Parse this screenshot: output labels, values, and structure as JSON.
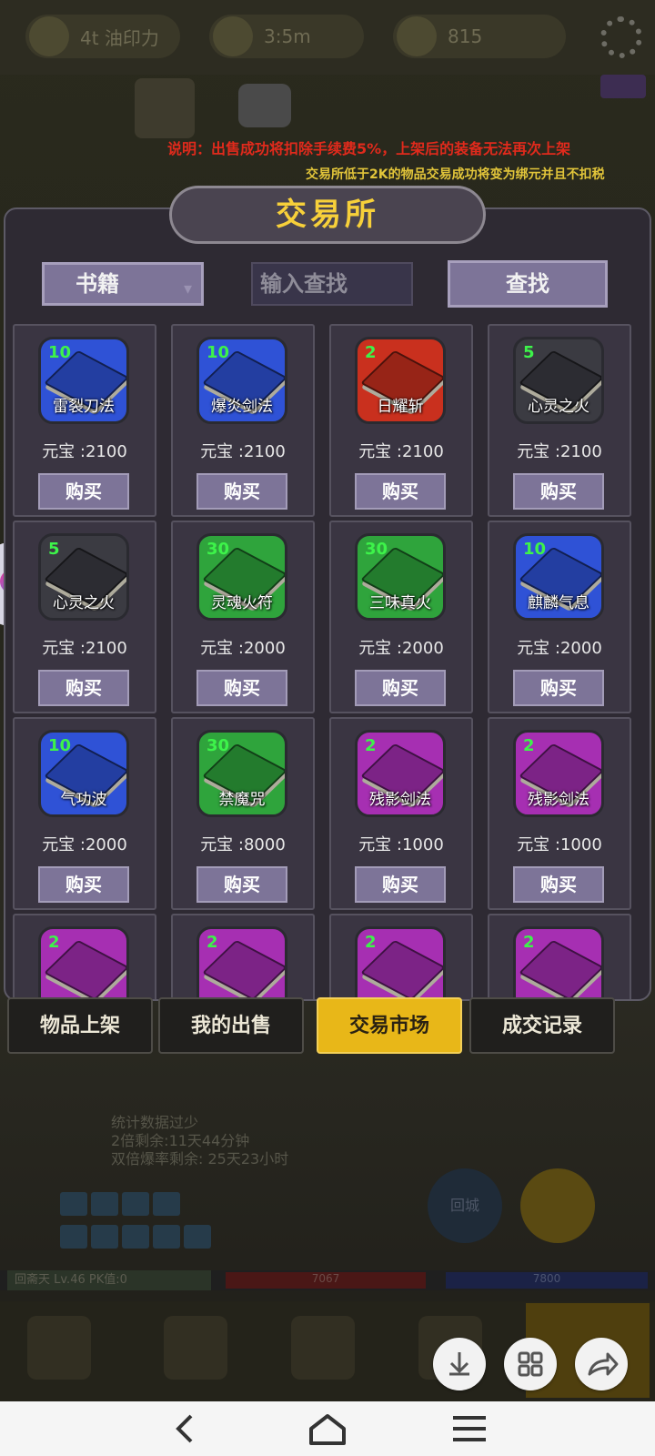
{
  "background": {
    "resources": [
      "4t 油印力",
      "3:5m",
      "815"
    ],
    "stats_lines": [
      "统计数据过少",
      "2倍剩余:11天44分钟",
      "双倍爆率剩余: 25天23小时"
    ],
    "player_bar": {
      "name": "回斋天  Lv.46 PK值:0",
      "hp": "7067",
      "mp": "7800"
    },
    "return_city": "回城"
  },
  "notices": {
    "line1": "说明：出售成功将扣除手续费5%，上架后的装备无法再次上架",
    "line2": "交易所低于2K的物品交易成功将变为绑元并且不扣税"
  },
  "dialog": {
    "title": "交易所",
    "category": "书籍",
    "search_placeholder": "输入查找",
    "search_button": "查找",
    "buy_label": "购买",
    "items": [
      {
        "name": "雷裂刀法",
        "qty": "10",
        "price": "元宝 :2100",
        "rarity": "blue"
      },
      {
        "name": "爆炎剑法",
        "qty": "10",
        "price": "元宝 :2100",
        "rarity": "blue"
      },
      {
        "name": "日耀斩",
        "qty": "2",
        "price": "元宝 :2100",
        "rarity": "red"
      },
      {
        "name": "心灵之火",
        "qty": "5",
        "price": "元宝 :2100",
        "rarity": "dark"
      },
      {
        "name": "心灵之火",
        "qty": "5",
        "price": "元宝 :2100",
        "rarity": "dark"
      },
      {
        "name": "灵魂火符",
        "qty": "30",
        "price": "元宝 :2000",
        "rarity": "green"
      },
      {
        "name": "三味真火",
        "qty": "30",
        "price": "元宝 :2000",
        "rarity": "green"
      },
      {
        "name": "麒麟气息",
        "qty": "10",
        "price": "元宝 :2000",
        "rarity": "blue"
      },
      {
        "name": "气功波",
        "qty": "10",
        "price": "元宝 :2000",
        "rarity": "blue"
      },
      {
        "name": "禁魔咒",
        "qty": "30",
        "price": "元宝 :8000",
        "rarity": "green"
      },
      {
        "name": "残影剑法",
        "qty": "2",
        "price": "元宝 :1000",
        "rarity": "purple"
      },
      {
        "name": "残影剑法",
        "qty": "2",
        "price": "元宝 :1000",
        "rarity": "purple"
      },
      {
        "name": "",
        "qty": "2",
        "price": "",
        "rarity": "purple"
      },
      {
        "name": "",
        "qty": "2",
        "price": "",
        "rarity": "purple"
      },
      {
        "name": "",
        "qty": "2",
        "price": "",
        "rarity": "purple"
      },
      {
        "name": "",
        "qty": "2",
        "price": "",
        "rarity": "purple"
      }
    ]
  },
  "tabs": [
    {
      "label": "物品上架",
      "active": false
    },
    {
      "label": "我的出售",
      "active": false
    },
    {
      "label": "交易市场",
      "active": true
    },
    {
      "label": "成交记录",
      "active": false
    }
  ],
  "fabs": [
    "download-icon",
    "grid-icon",
    "share-icon"
  ],
  "system_nav": [
    "back-icon",
    "home-icon",
    "menu-icon"
  ],
  "colors": {
    "title_gold": "#f7d03a",
    "notice_red": "#e02a1c",
    "notice_yellow": "#e2c53a",
    "qty_green": "#3df34a",
    "tab_active": "#e8b718",
    "rarity": {
      "blue": "#2f52d6",
      "red": "#c9301e",
      "dark": "#3b3b42",
      "green": "#2fa43c",
      "purple": "#a62fb2"
    }
  }
}
